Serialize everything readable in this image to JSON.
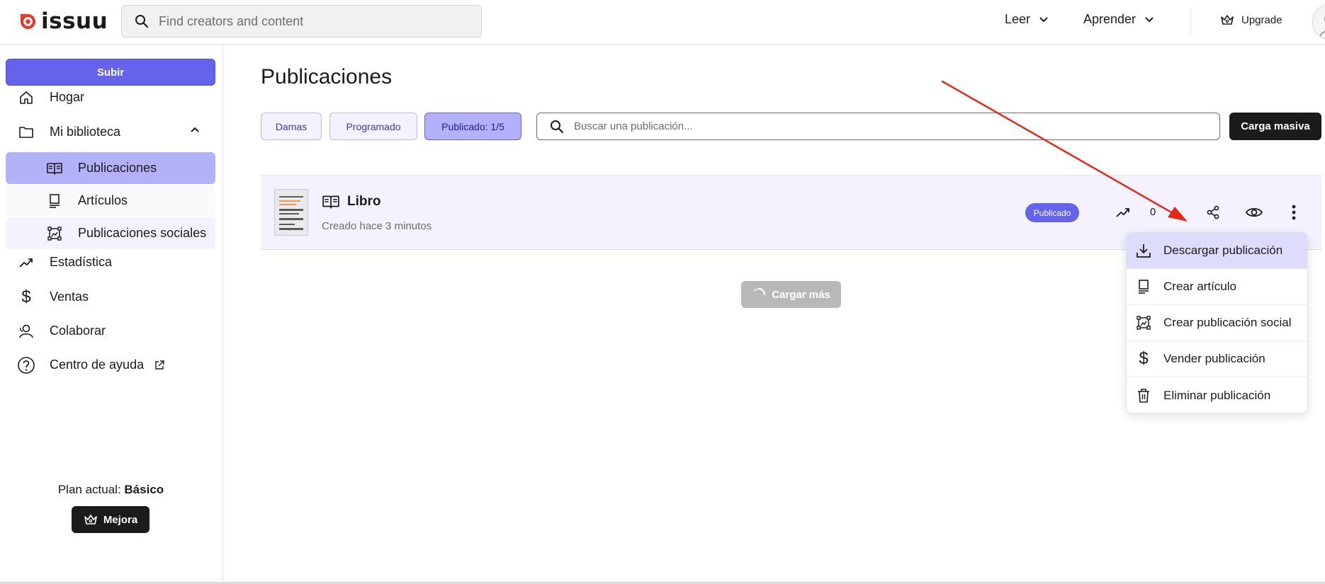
{
  "brand": {
    "name": "issuu",
    "color": "#e43b2d"
  },
  "topbar": {
    "search_placeholder": "Find creators and content",
    "nav": [
      {
        "label": "Leer"
      },
      {
        "label": "Aprender"
      }
    ],
    "upgrade_label": "Upgrade"
  },
  "sidebar": {
    "upload_label": "Subir",
    "items": [
      {
        "label": "Hogar",
        "icon": "home-icon"
      },
      {
        "label": "Mi biblioteca",
        "icon": "folder-icon",
        "expanded": true
      },
      {
        "label": "Publicaciones",
        "icon": "book-open-icon",
        "active": true
      },
      {
        "label": "Artículos",
        "icon": "article-icon"
      },
      {
        "label": "Publicaciones sociales",
        "icon": "social-image-icon"
      },
      {
        "label": "Estadística",
        "icon": "trend-icon"
      },
      {
        "label": "Ventas",
        "icon": "dollar-icon"
      },
      {
        "label": "Colaborar",
        "icon": "collaborate-icon"
      },
      {
        "label": "Centro de ayuda",
        "icon": "help-icon"
      }
    ],
    "plan_prefix": "Plan actual: ",
    "plan_name": "Básico",
    "upgrade_button": "Mejora"
  },
  "main": {
    "title": "Publicaciones",
    "filters": [
      {
        "label": "Damas",
        "selected": false
      },
      {
        "label": "Programado",
        "selected": false
      },
      {
        "label": "Publicado: 1/5",
        "selected": true
      }
    ],
    "search_placeholder": "Buscar una publicación...",
    "bulk_upload_label": "Carga masiva",
    "publication": {
      "title": "Libro",
      "subtitle": "Creado hace 3 minutos",
      "status": "Publicado",
      "views_count": "0"
    },
    "load_more_label": "Cargar más"
  },
  "menu": {
    "items": [
      {
        "label": "Descargar publicación",
        "icon": "download-icon",
        "highlighted": true
      },
      {
        "label": "Crear artículo",
        "icon": "article-icon"
      },
      {
        "label": "Crear publicación social",
        "icon": "social-image-icon"
      },
      {
        "label": "Vender publicación",
        "icon": "dollar-icon"
      },
      {
        "label": "Eliminar publicación",
        "icon": "trash-icon"
      }
    ]
  },
  "colors": {
    "accent": "#6562ec",
    "accent_light": "#b3b1fa",
    "accent_bg": "#f3f2fe",
    "annotation_arrow": "#e8271b"
  }
}
